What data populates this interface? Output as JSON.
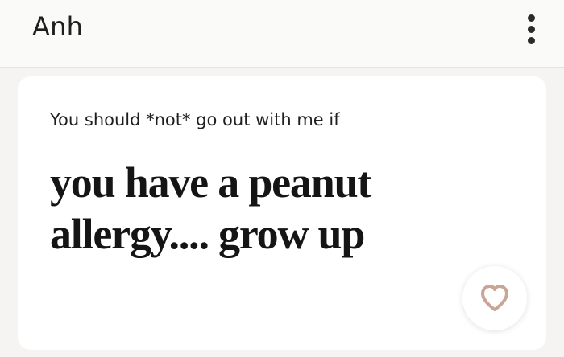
{
  "header": {
    "name": "Anh",
    "menu_icon": "more-vertical-icon"
  },
  "prompt": {
    "question": "You should *not* go out with me if",
    "answer": "you have a peanut allergy.... grow up"
  },
  "like_button": {
    "icon": "heart-outline-icon",
    "color": "#c9a596"
  }
}
